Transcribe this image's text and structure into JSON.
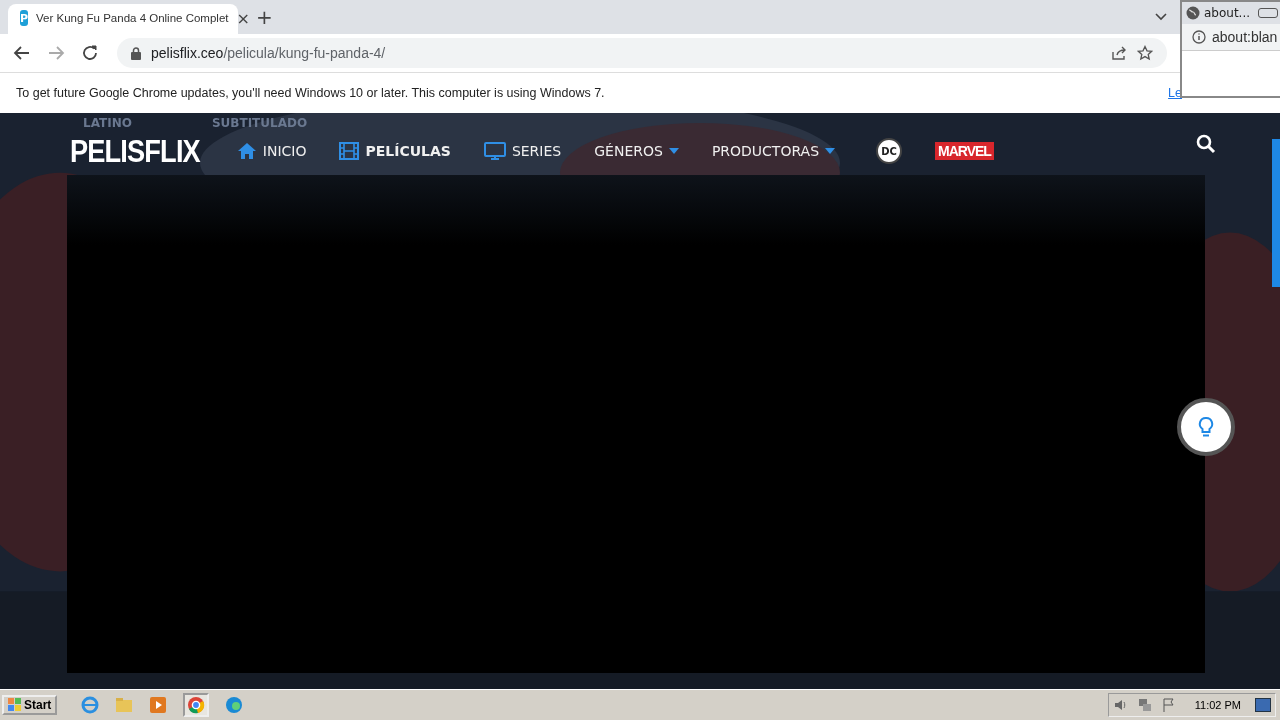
{
  "browser": {
    "tab": {
      "title": "Ver Kung Fu Panda 4 Online Complet",
      "favicon": "P",
      "close": "×"
    },
    "new_tab": "+",
    "url": {
      "host": "pelisflix.ceo",
      "path": "/pelicula/kung-fu-panda-4/"
    }
  },
  "infobar": {
    "message": "To get future Google Chrome updates, you'll need Windows 10 or later. This computer is using Windows 7.",
    "link": "Le"
  },
  "popup_window": {
    "tab_title": "about...",
    "address": "about:blan"
  },
  "site": {
    "logo": "PELISFLIX",
    "background_texts": [
      {
        "text": "LATINO",
        "kind": "heading"
      },
      {
        "text": "SUBTITULADO",
        "kind": "heading"
      }
    ],
    "nav": [
      {
        "label": "INICIO",
        "kind": "home",
        "dropdown": false,
        "selected": false
      },
      {
        "label": "PELÍCULAS",
        "kind": "film",
        "dropdown": false,
        "selected": true
      },
      {
        "label": "SERIES",
        "kind": "tv",
        "dropdown": false,
        "selected": false
      },
      {
        "label": "GÉNEROS",
        "kind": "menu",
        "dropdown": true,
        "selected": false
      },
      {
        "label": "PRODUCTORAS",
        "kind": "menu",
        "dropdown": true,
        "selected": false
      }
    ],
    "brands": [
      {
        "label": "DC",
        "kind": "circle"
      },
      {
        "label": "MARVEL",
        "kind": "box"
      }
    ]
  },
  "taskbar": {
    "start": "Start",
    "clock": "11:02 PM"
  }
}
